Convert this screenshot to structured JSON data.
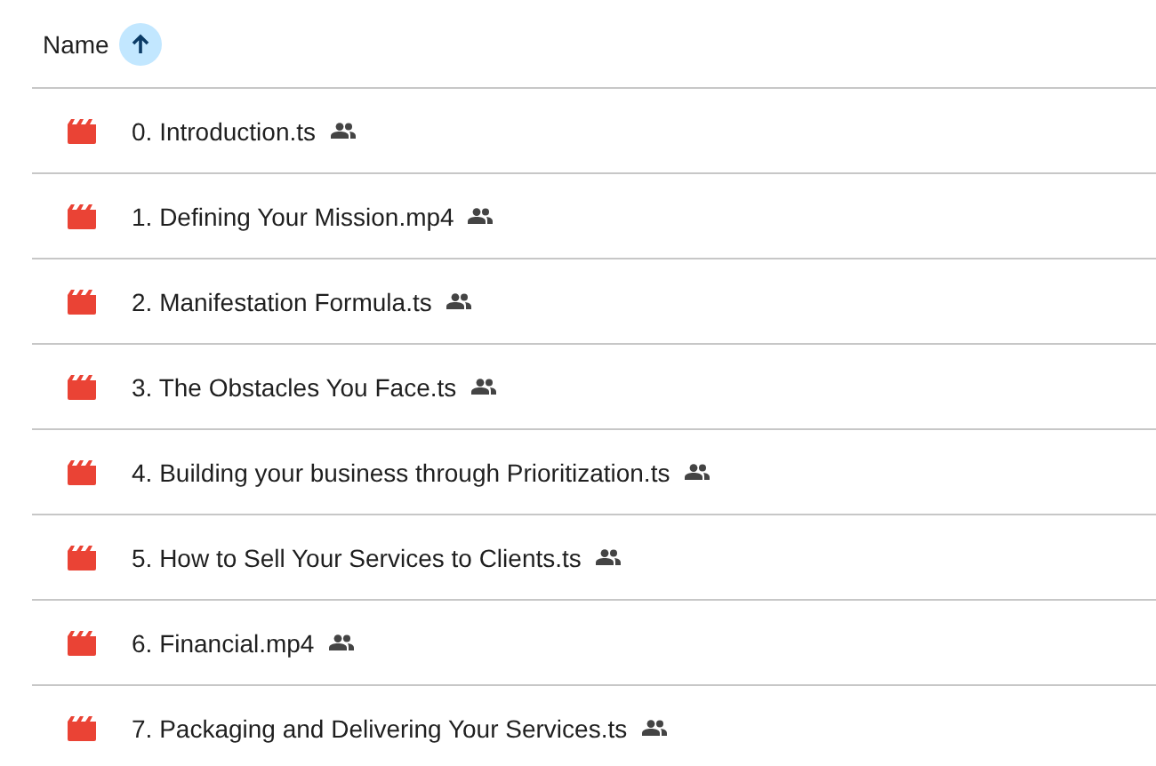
{
  "header": {
    "label": "Name",
    "ascending": true
  },
  "files": [
    {
      "name": "0. Introduction.ts",
      "kind": "video",
      "shared": true
    },
    {
      "name": "1. Defining Your Mission.mp4",
      "kind": "video",
      "shared": true
    },
    {
      "name": "2. Manifestation Formula.ts",
      "kind": "video",
      "shared": true
    },
    {
      "name": "3. The Obstacles You Face.ts",
      "kind": "video",
      "shared": true
    },
    {
      "name": "4. Building your business through Prioritization.ts",
      "kind": "video",
      "shared": true
    },
    {
      "name": "5. How to Sell Your Services to Clients.ts",
      "kind": "video",
      "shared": true
    },
    {
      "name": "6. Financial.mp4",
      "kind": "video",
      "shared": true
    },
    {
      "name": "7. Packaging and Delivering Your Services.ts",
      "kind": "video",
      "shared": true
    }
  ]
}
